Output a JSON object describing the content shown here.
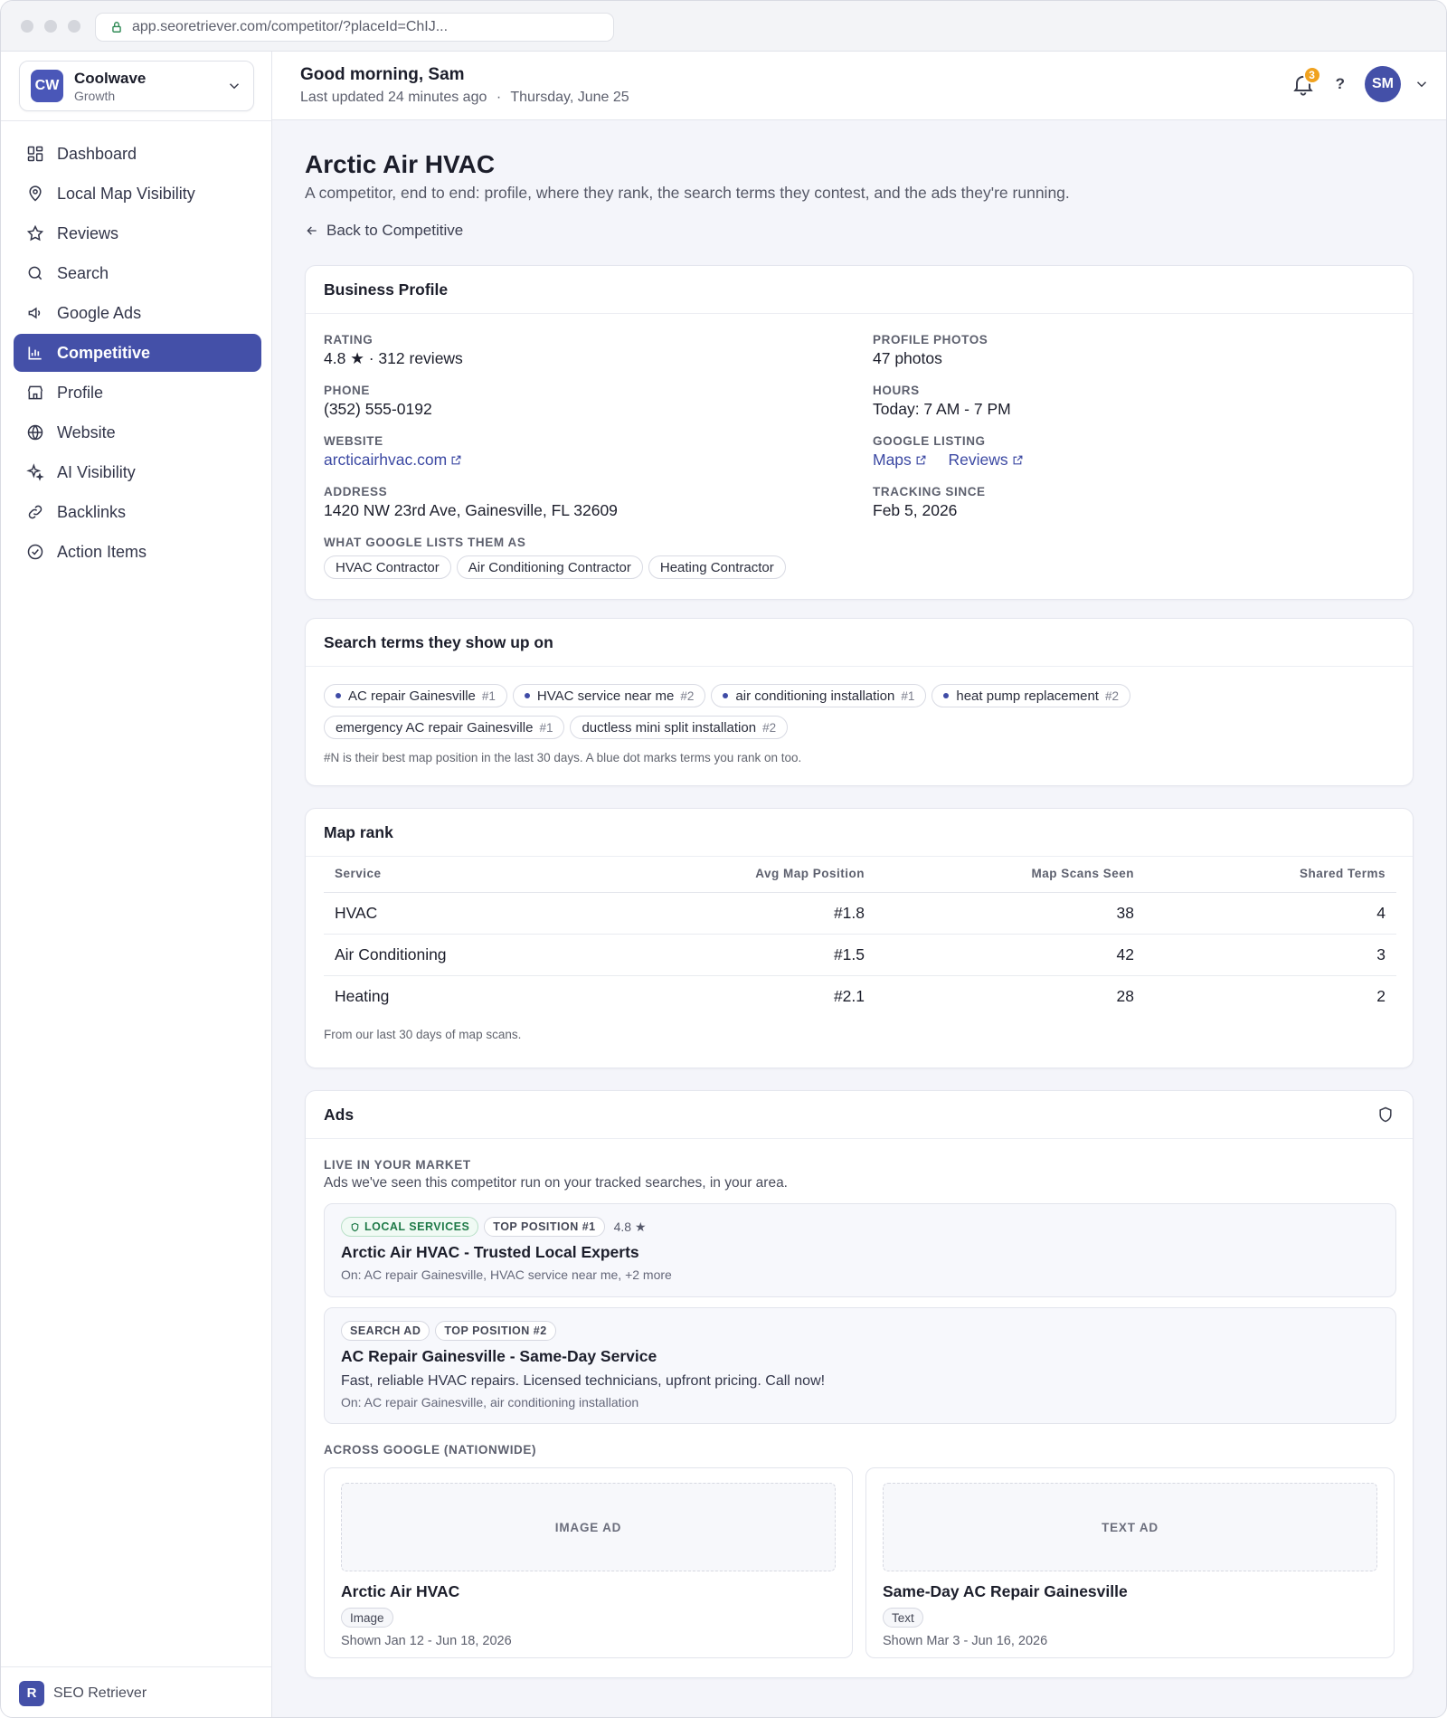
{
  "browser": {
    "url": "app.seoretriever.com/competitor/?placeId=ChIJ..."
  },
  "sidebar": {
    "workspace": {
      "initials": "CW",
      "name": "Coolwave",
      "plan": "Growth"
    },
    "items": [
      {
        "label": "Dashboard",
        "icon": "dashboard-icon"
      },
      {
        "label": "Local Map Visibility",
        "icon": "map-pin-icon"
      },
      {
        "label": "Reviews",
        "icon": "star-icon"
      },
      {
        "label": "Search",
        "icon": "search-icon"
      },
      {
        "label": "Google Ads",
        "icon": "megaphone-icon"
      },
      {
        "label": "Competitive",
        "icon": "bar-chart-icon",
        "active": true
      },
      {
        "label": "Profile",
        "icon": "storefront-icon"
      },
      {
        "label": "Website",
        "icon": "globe-icon"
      },
      {
        "label": "AI Visibility",
        "icon": "sparkles-icon"
      },
      {
        "label": "Backlinks",
        "icon": "link-icon"
      },
      {
        "label": "Action Items",
        "icon": "check-circle-icon"
      }
    ],
    "footer": {
      "logo": "R",
      "label": "SEO Retriever"
    }
  },
  "topbar": {
    "greeting": "Good morning, Sam",
    "updated": "Last updated 24 minutes ago",
    "separator": "·",
    "date": "Thursday, June 25",
    "notification_count": "3",
    "help": "?",
    "avatar_initials": "SM"
  },
  "page": {
    "title": "Arctic Air HVAC",
    "subtitle": "A competitor, end to end: profile, where they rank, the search terms they contest, and the ads they're running.",
    "back_label": "Back to Competitive"
  },
  "business_profile": {
    "title": "Business Profile",
    "rating_label": "Rating",
    "rating_value": "4.8 ★ · 312 reviews",
    "phone_label": "Phone",
    "phone_value": "(352) 555-0192",
    "website_label": "Website",
    "website_value": "arcticairhvac.com",
    "address_label": "Address",
    "address_value": "1420 NW 23rd Ave, Gainesville, FL 32609",
    "categories_label": "What Google lists them as",
    "categories": [
      "HVAC Contractor",
      "Air Conditioning Contractor",
      "Heating Contractor"
    ],
    "photos_label": "Profile photos",
    "photos_value": "47 photos",
    "hours_label": "Hours",
    "hours_value": "Today: 7 AM - 7 PM",
    "listing_label": "Google listing",
    "listing_maps": "Maps",
    "listing_reviews": "Reviews",
    "tracking_label": "Tracking since",
    "tracking_value": "Feb 5, 2026"
  },
  "search_terms": {
    "title": "Search terms they show up on",
    "terms": [
      {
        "term": "AC repair Gainesville",
        "rank": "#1",
        "shared": true
      },
      {
        "term": "HVAC service near me",
        "rank": "#2",
        "shared": true
      },
      {
        "term": "air conditioning installation",
        "rank": "#1",
        "shared": true
      },
      {
        "term": "heat pump replacement",
        "rank": "#2",
        "shared": true
      },
      {
        "term": "emergency AC repair Gainesville",
        "rank": "#1",
        "shared": false
      },
      {
        "term": "ductless mini split installation",
        "rank": "#2",
        "shared": false
      }
    ],
    "note": "#N is their best map position in the last 30 days. A blue dot marks terms you rank on too."
  },
  "map_rank": {
    "title": "Map rank",
    "columns": [
      "Service",
      "Avg Map Position",
      "Map Scans Seen",
      "Shared Terms"
    ],
    "rows": [
      {
        "service": "HVAC",
        "avg": "#1.8",
        "scans": "38",
        "shared": "4"
      },
      {
        "service": "Air Conditioning",
        "avg": "#1.5",
        "scans": "42",
        "shared": "3"
      },
      {
        "service": "Heating",
        "avg": "#2.1",
        "scans": "28",
        "shared": "2"
      }
    ],
    "note": "From our last 30 days of map scans."
  },
  "ads": {
    "title": "Ads",
    "live_label": "Live in your market",
    "live_sub": "Ads we've seen this competitor run on your tracked searches, in your area.",
    "live_ads": [
      {
        "type": "Local Services",
        "position": "Top position #1",
        "rating": "4.8 ★",
        "title": "Arctic Air HVAC - Trusted Local Experts",
        "desc": "",
        "on": "On: AC repair Gainesville, HVAC service near me, +2 more"
      },
      {
        "type": "Search Ad",
        "position": "Top position #2",
        "rating": "",
        "title": "AC Repair Gainesville - Same-Day Service",
        "desc": "Fast, reliable HVAC repairs. Licensed technicians, upfront pricing. Call now!",
        "on": "On: AC repair Gainesville, air conditioning installation"
      }
    ],
    "nationwide_label": "Across Google (Nationwide)",
    "nationwide": [
      {
        "placeholder": "IMAGE AD",
        "title": "Arctic Air HVAC",
        "format": "Image",
        "shown": "Shown Jan 12 - Jun 18, 2026"
      },
      {
        "placeholder": "TEXT AD",
        "title": "Same-Day AC Repair Gainesville",
        "format": "Text",
        "shown": "Shown Mar 3 - Jun 16, 2026"
      }
    ]
  }
}
